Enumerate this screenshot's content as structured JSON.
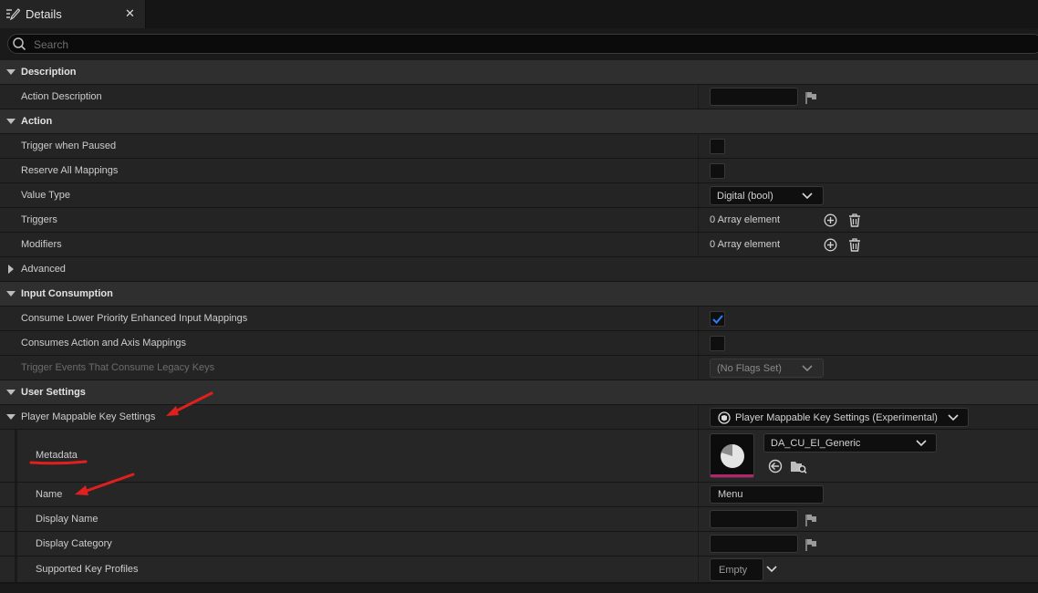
{
  "tab": {
    "title": "Details",
    "close": "✕",
    "icon": "details-pencil-icon"
  },
  "search": {
    "placeholder": "Search",
    "value": ""
  },
  "description": {
    "header": "Description",
    "action_description": {
      "label": "Action Description",
      "value": ""
    }
  },
  "action": {
    "header": "Action",
    "trigger_when_paused": {
      "label": "Trigger when Paused",
      "checked": false
    },
    "reserve_all_mappings": {
      "label": "Reserve All Mappings",
      "checked": false
    },
    "value_type": {
      "label": "Value Type",
      "value": "Digital (bool)"
    },
    "triggers": {
      "label": "Triggers",
      "value": "0 Array element"
    },
    "modifiers": {
      "label": "Modifiers",
      "value": "0 Array element"
    }
  },
  "advanced": {
    "label": "Advanced"
  },
  "input_consumption": {
    "header": "Input Consumption",
    "consume_lower_priority": {
      "label": "Consume Lower Priority Enhanced Input Mappings",
      "checked": true
    },
    "consumes_action_axis": {
      "label": "Consumes Action and Axis Mappings",
      "checked": false
    },
    "trigger_events_legacy": {
      "label": "Trigger Events That Consume Legacy Keys",
      "value": "(No Flags Set)"
    }
  },
  "user_settings": {
    "header": "User Settings",
    "player_mappable": {
      "label": "Player Mappable Key Settings",
      "value": "Player Mappable Key Settings (Experimental)"
    },
    "metadata": {
      "label": "Metadata",
      "asset": "DA_CU_EI_Generic"
    },
    "name": {
      "label": "Name",
      "value": "Menu"
    },
    "display_name": {
      "label": "Display Name",
      "value": ""
    },
    "display_category": {
      "label": "Display Category",
      "value": ""
    },
    "supported_key_profiles": {
      "label": "Supported Key Profiles",
      "value": "Empty"
    }
  },
  "colors": {
    "panel": "#242424",
    "category": "#2f2f2f",
    "accent_check": "#2a7fff",
    "thumbnail_underline": "#b4236b",
    "annotation": "#e0201e"
  }
}
